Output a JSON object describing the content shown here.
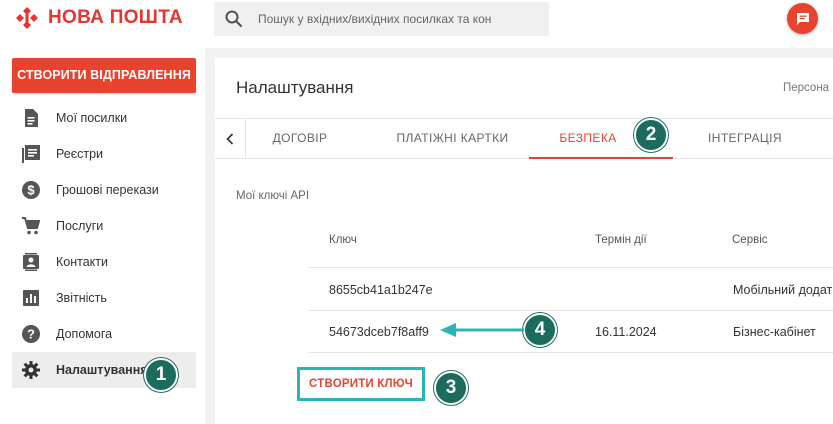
{
  "header": {
    "logo_text": "НОВА ПОШТА",
    "logo_color": "#e8342f",
    "search_placeholder": "Пошук у вхідних/вихідних посилках та кон",
    "chat_icon": "chat-icon"
  },
  "sidebar": {
    "create_button": "СТВОРИТИ ВІДПРАВЛЕННЯ",
    "items": [
      {
        "label": "Мої посилки",
        "icon": "document-icon",
        "active": false
      },
      {
        "label": "Реєстри",
        "icon": "registry-icon",
        "active": false
      },
      {
        "label": "Грошові перекази",
        "icon": "dollar-icon",
        "active": false
      },
      {
        "label": "Послуги",
        "icon": "cart-icon",
        "active": false
      },
      {
        "label": "Контакти",
        "icon": "contacts-icon",
        "active": false
      },
      {
        "label": "Звітність",
        "icon": "bar-chart-icon",
        "active": false
      },
      {
        "label": "Допомога",
        "icon": "help-icon",
        "active": false
      },
      {
        "label": "Налаштування",
        "icon": "gear-icon",
        "active": true
      }
    ]
  },
  "main": {
    "title": "Налаштування",
    "persona_text": "Персона",
    "tabs": [
      {
        "label": "ДОГОВІР",
        "active": false
      },
      {
        "label": "ПЛАТІЖНІ КАРТКИ",
        "active": false
      },
      {
        "label": "БЕЗПЕКА",
        "active": true
      },
      {
        "label": "ІНТЕГРАЦІЯ",
        "active": false
      }
    ],
    "section_label": "Мої ключі API",
    "table": {
      "columns": [
        "Ключ",
        "Термін дії",
        "Сервіс"
      ],
      "rows": [
        {
          "key": "8655cb41a1b247e",
          "expiry": "",
          "service": "Мобільний додат"
        },
        {
          "key": "54673dceb7f8aff9",
          "expiry": "16.11.2024",
          "service": "Бізнес-кабінет"
        }
      ]
    },
    "create_key_button": "СТВОРИТИ КЛЮЧ"
  },
  "annotations": {
    "badges": [
      "1",
      "2",
      "3",
      "4"
    ],
    "badge_color": "#1b6b5f",
    "highlight_color": "#2ab6b6"
  },
  "colors": {
    "accent": "#e8432f"
  }
}
